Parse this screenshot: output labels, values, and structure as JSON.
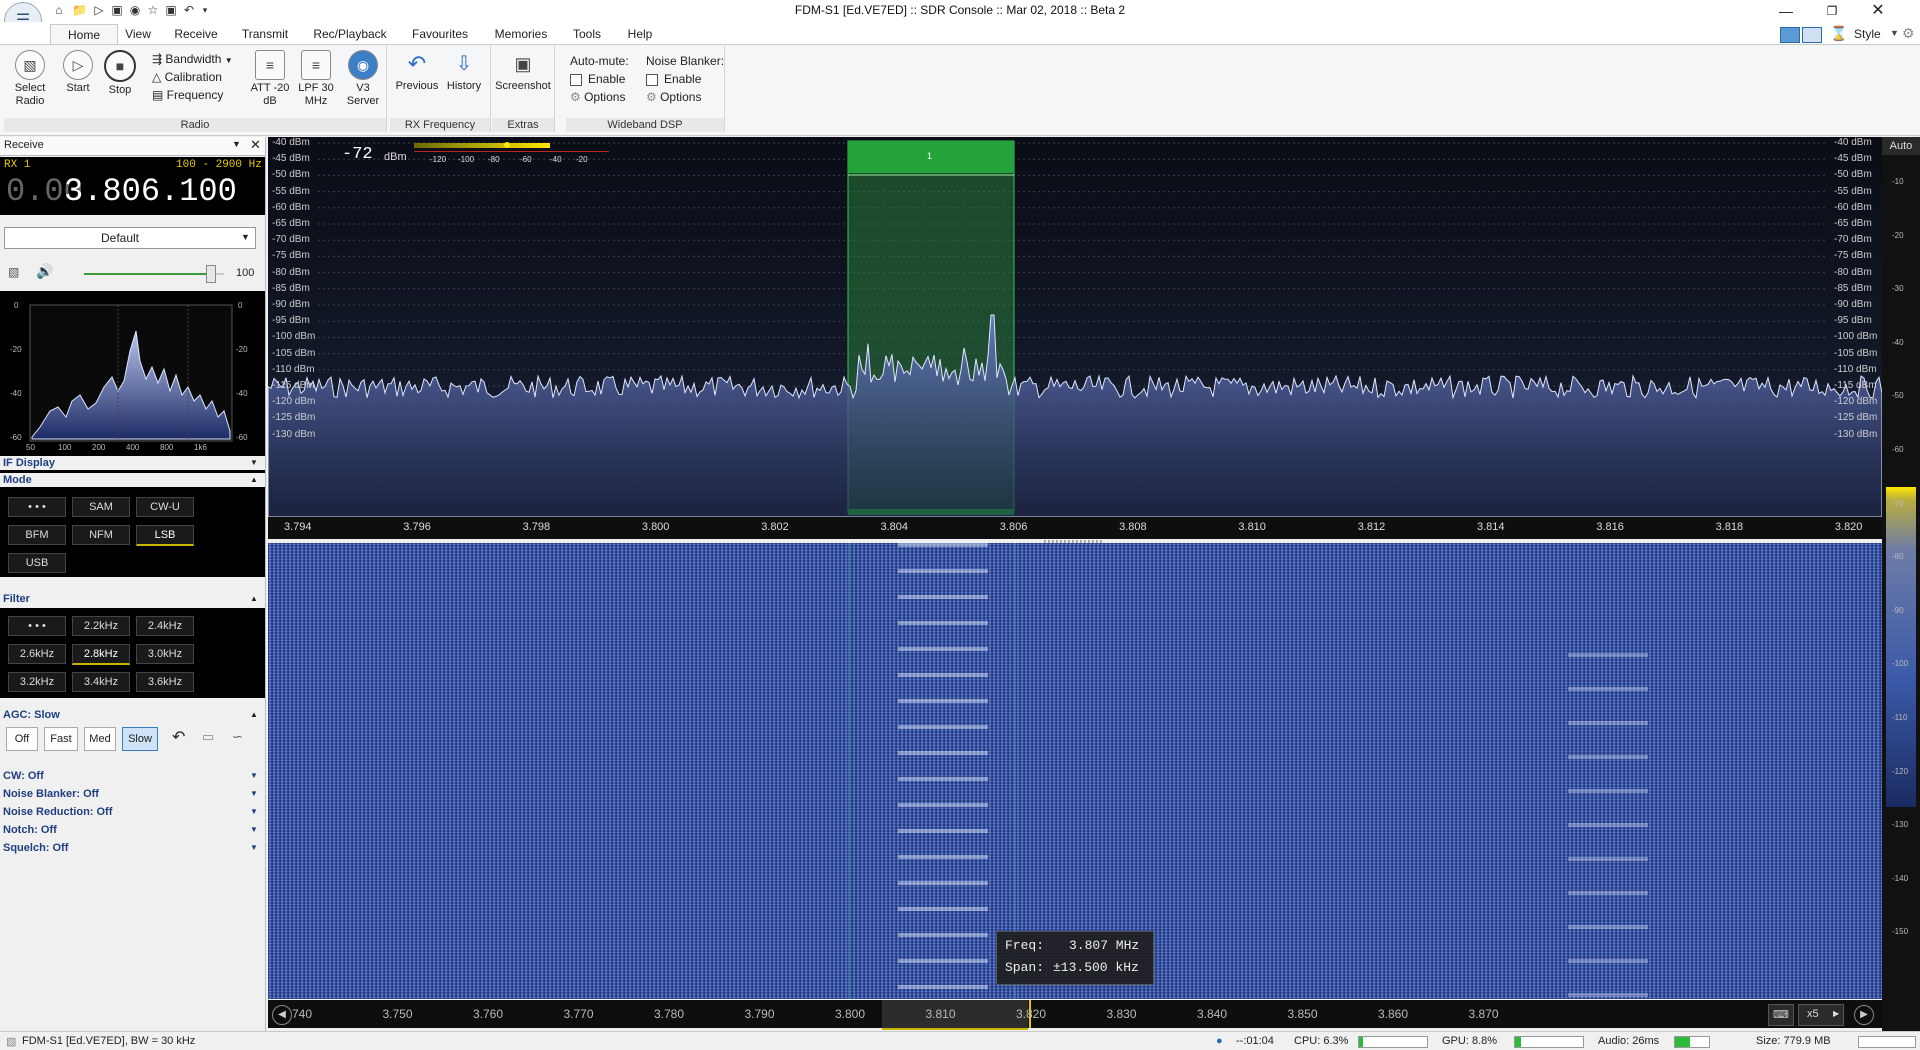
{
  "window": {
    "title": "FDM-S1 [Ed.VE7ED] :: SDR Console :: Mar 02, 2018 :: Beta 2",
    "style_label": "Style"
  },
  "tabs": [
    "Home",
    "View",
    "Receive",
    "Transmit",
    "Rec/Playback",
    "Favourites",
    "Memories",
    "Tools",
    "Help"
  ],
  "ribbon": {
    "radio": {
      "select_radio": "Select Radio",
      "start": "Start",
      "stop": "Stop",
      "bandwidth": "Bandwidth",
      "calibration": "Calibration",
      "frequency": "Frequency",
      "att": "ATT -20 dB",
      "lpf": "LPF 30 MHz",
      "v3server": "V3 Server",
      "group_label": "Radio"
    },
    "rx_frequency": {
      "previous": "Previous",
      "history": "History",
      "group_label": "RX Frequency"
    },
    "extras": {
      "screenshot": "Screenshot",
      "group_label": "Extras"
    },
    "wideband_dsp": {
      "auto_mute": "Auto-mute:",
      "enable1": "Enable",
      "options1": "Options",
      "noise_blanker": "Noise Blanker:",
      "enable2": "Enable",
      "options2": "Options",
      "group_label": "Wideband DSP"
    }
  },
  "left": {
    "receive_label": "Receive",
    "rx_label": "RX 1",
    "range": "100 - 2900 Hz",
    "frequency_dim": "0.00",
    "frequency": "3.806.100",
    "profile": "Default",
    "volume_value": "100",
    "volume_fraction": 0.9,
    "audio_spectrum": {
      "y_ticks": [
        "0",
        "-20",
        "-40",
        "-60"
      ],
      "x_ticks": [
        "50",
        "100",
        "200",
        "400",
        "800",
        "1k6"
      ]
    },
    "if_display": "IF Display",
    "mode_label": "Mode",
    "modes": [
      "• • •",
      "SAM",
      "CW-U",
      "BFM",
      "NFM",
      "LSB",
      "USB"
    ],
    "mode_selected": "LSB",
    "filter_label": "Filter",
    "filters": [
      "• • •",
      "2.2kHz",
      "2.4kHz",
      "2.6kHz",
      "2.8kHz",
      "3.0kHz",
      "3.2kHz",
      "3.4kHz",
      "3.6kHz"
    ],
    "filter_selected": "2.8kHz",
    "agc_label": "AGC: Slow",
    "agc_buttons": [
      "Off",
      "Fast",
      "Med",
      "Slow"
    ],
    "options": [
      "CW: Off",
      "Noise Blanker: Off",
      "Noise Reduction: Off",
      "Notch: Off",
      "Squelch: Off"
    ]
  },
  "spectrum": {
    "level_value": "-72",
    "level_unit": "dBm",
    "meter_ticks": [
      "-120",
      "-100",
      "-80",
      "-60",
      "-40",
      "-20"
    ],
    "db_labels": [
      "-40 dBm",
      "-45 dBm",
      "-50 dBm",
      "-55 dBm",
      "-60 dBm",
      "-65 dBm",
      "-70 dBm",
      "-75 dBm",
      "-80 dBm",
      "-85 dBm",
      "-90 dBm",
      "-95 dBm",
      "-100 dBm",
      "-105 dBm",
      "-110 dBm",
      "-115 dBm",
      "-120 dBm",
      "-125 dBm",
      "-130 dBm"
    ],
    "freq_labels": [
      "3.794",
      "3.796",
      "3.798",
      "3.800",
      "3.802",
      "3.804",
      "3.806",
      "3.808",
      "3.810",
      "3.812",
      "3.814",
      "3.816",
      "3.818",
      "3.820"
    ],
    "vfo_marker": "1",
    "auto_label": "Auto",
    "right_scale": [
      "-10",
      "-20",
      "-30",
      "-40",
      "-50",
      "-60",
      "-70",
      "-80",
      "-90",
      "-100",
      "-110",
      "-120",
      "-130",
      "-140",
      "-150"
    ]
  },
  "waterfall": {
    "tooltip_freq_label": "Freq:",
    "tooltip_freq": "3.807 MHz",
    "tooltip_span_label": "Span:",
    "tooltip_span": "±13.500 kHz",
    "band_labels": [
      "740",
      "3.750",
      "3.760",
      "3.770",
      "3.780",
      "3.790",
      "3.800",
      "3.810",
      "3.820",
      "3.830",
      "3.840",
      "3.850",
      "3.860",
      "3.870"
    ],
    "zoom": "x5"
  },
  "status": {
    "radio": "FDM-S1 [Ed.VE7ED], BW = 30 kHz",
    "time": "--:01:04",
    "cpu": "CPU: 6.3%",
    "cpu_fraction": 0.063,
    "gpu": "GPU: 8.8%",
    "gpu_fraction": 0.088,
    "audio": "Audio: 26ms",
    "audio_fraction": 0.45,
    "size": "Size: 779.9 MB"
  }
}
